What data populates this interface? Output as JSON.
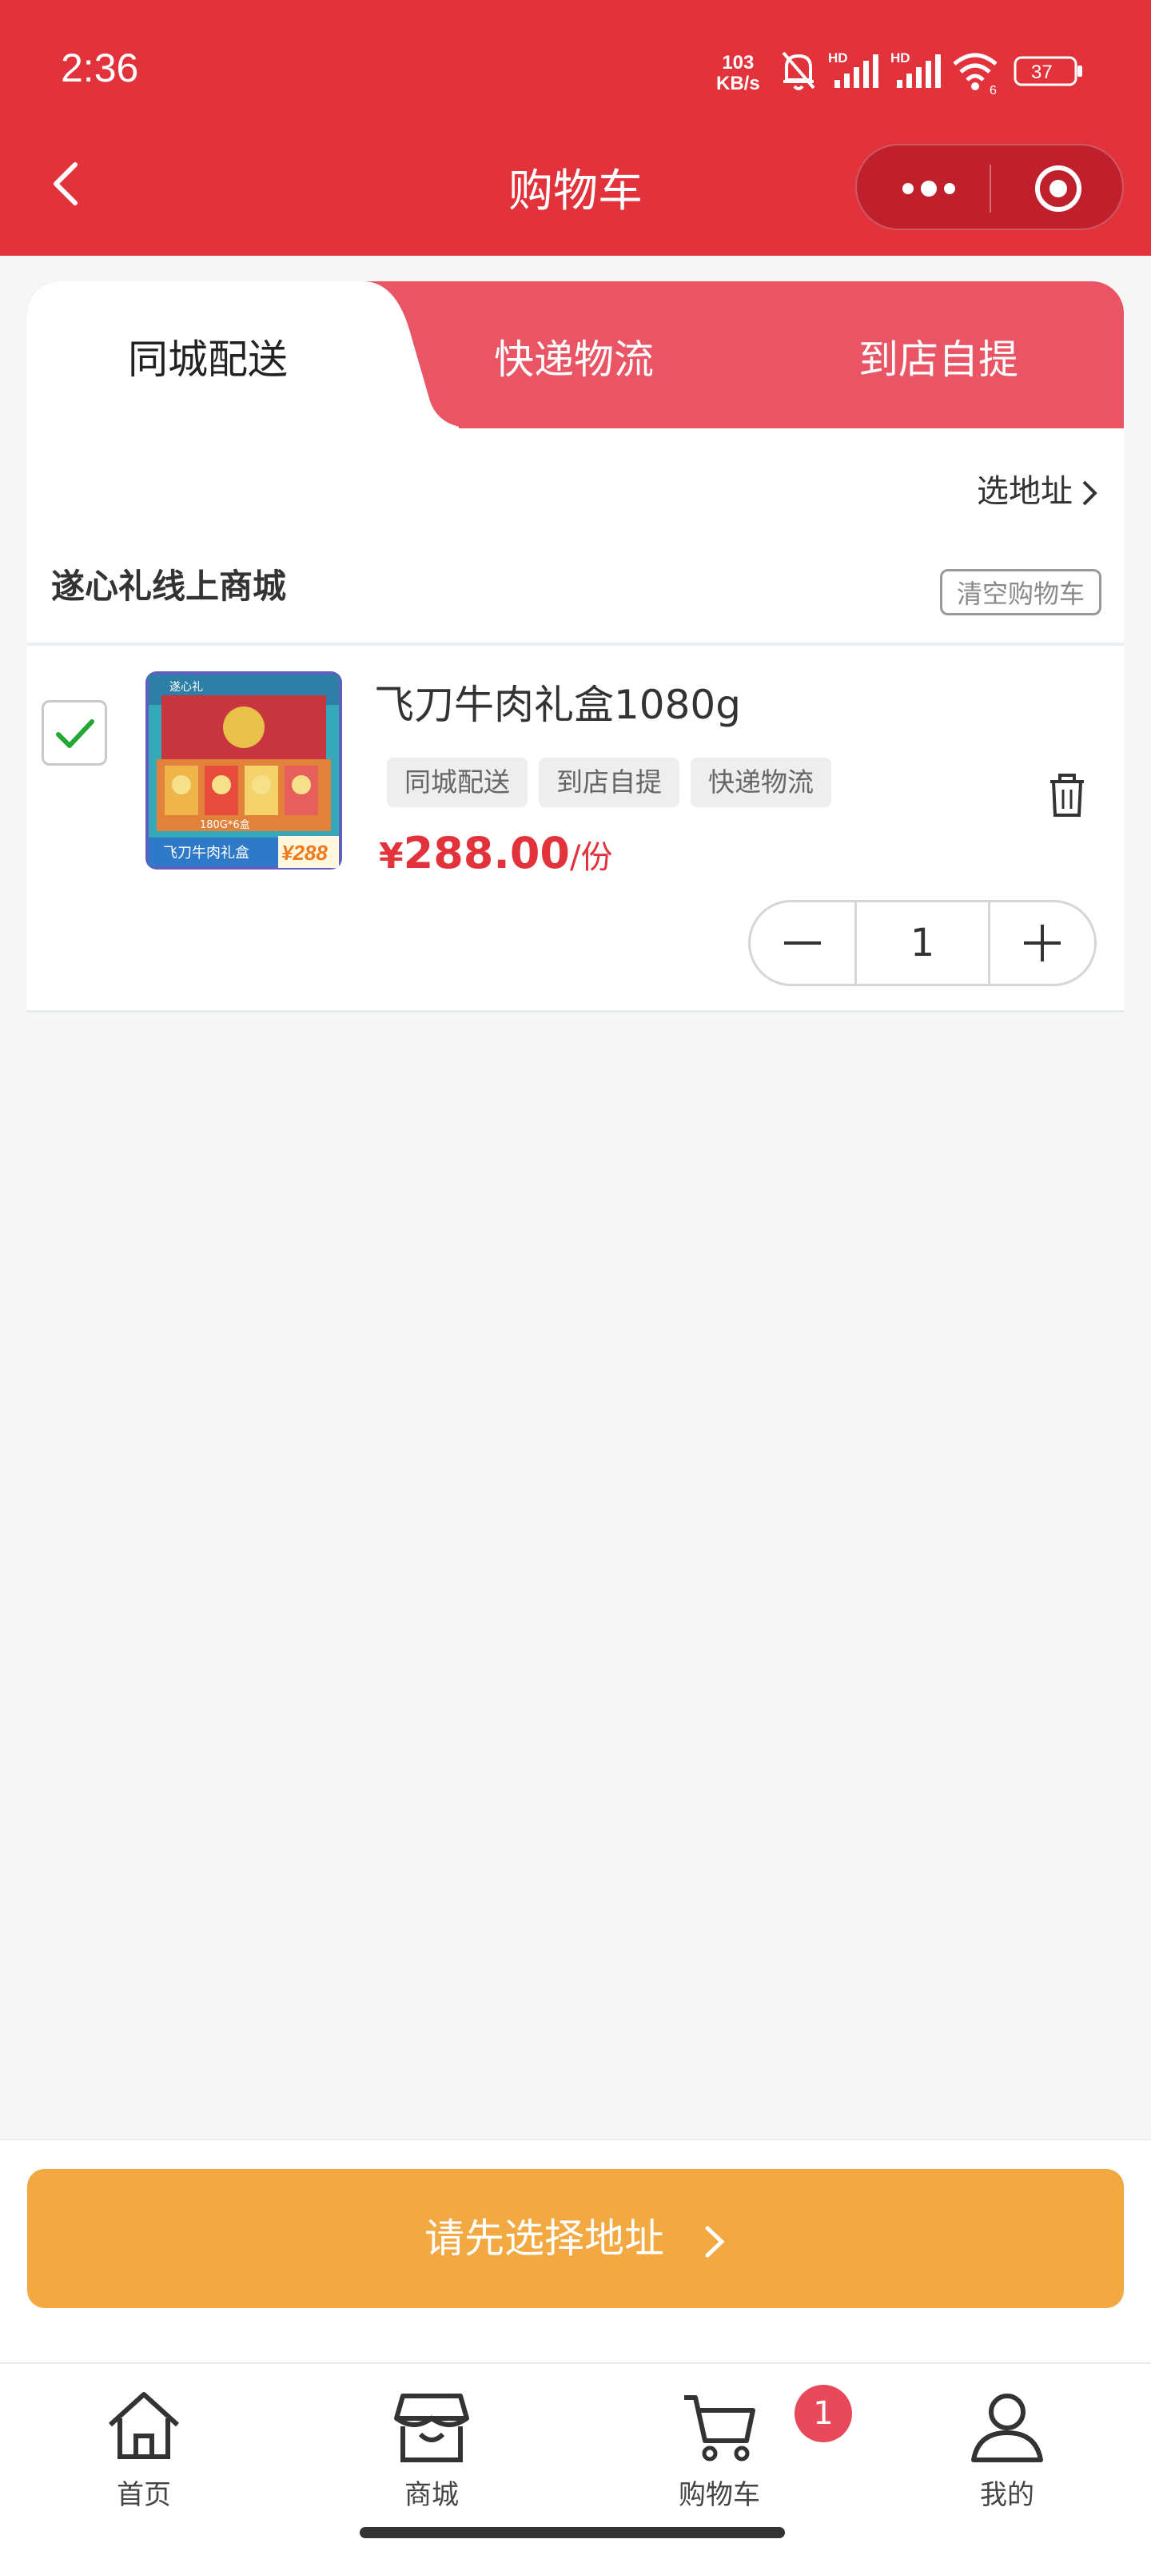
{
  "status_bar": {
    "time": "2:36",
    "speed_value": "103",
    "speed_unit": "KB/s",
    "hd1": "HD",
    "hd2": "HD",
    "wifi_sub": "6",
    "battery": "37"
  },
  "navbar": {
    "title": "购物车"
  },
  "tabs": [
    {
      "label": "同城配送",
      "active": true
    },
    {
      "label": "快递物流"
    },
    {
      "label": "到店自提"
    }
  ],
  "address": {
    "label": "选地址"
  },
  "shop": {
    "name": "遂心礼线上商城",
    "clear_label": "清空购物车"
  },
  "cart_item": {
    "name": "飞刀牛肉礼盒1080g",
    "tags": [
      "同城配送",
      "到店自提",
      "快递物流"
    ],
    "currency": "¥",
    "price": "288.00",
    "unit": "/份",
    "quantity": "1",
    "checked": true,
    "thumb_price": "¥288",
    "thumb_caption": "飞刀牛肉礼盒",
    "thumb_weight": "180G*6盒",
    "thumb_brand": "遂心礼"
  },
  "cta": {
    "label": "请先选择地址"
  },
  "tabbar": [
    {
      "label": "首页",
      "icon": "home-icon"
    },
    {
      "label": "商城",
      "icon": "store-icon"
    },
    {
      "label": "购物车",
      "icon": "cart-icon"
    },
    {
      "label": "我的",
      "icon": "user-icon"
    }
  ],
  "cart_badge": "1",
  "colors": {
    "brand_red": "#e2323b",
    "tab_pink": "#ea5566",
    "price_red": "#e2323b",
    "cta_orange": "#f2a942",
    "check_green": "#22a833"
  }
}
